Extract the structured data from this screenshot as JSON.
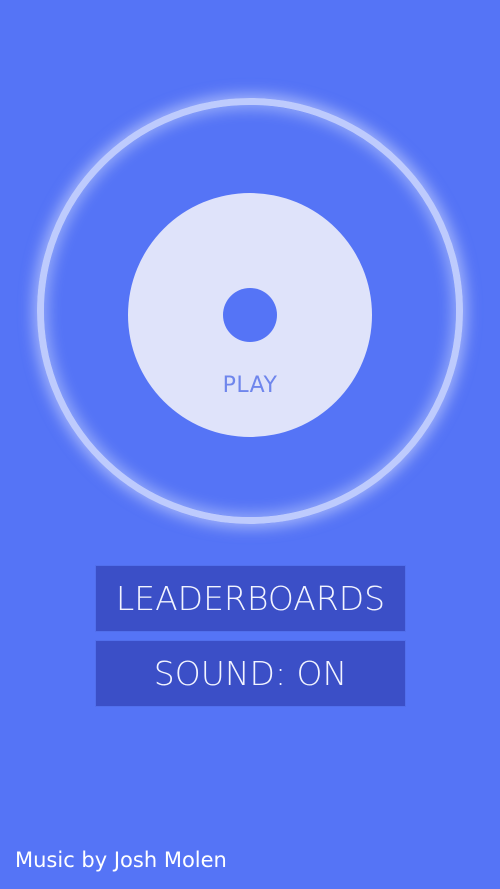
{
  "play_button": {
    "label": "PLAY"
  },
  "menu": {
    "leaderboards_label": "LEADERBOARDS",
    "sound_label": "SOUND: ON"
  },
  "footer": {
    "credit": "Music by Josh Molen"
  },
  "colors": {
    "background": "#5574f6",
    "disc": "#dfe3fa",
    "button": "#3b4fc7",
    "play_text": "#6f86ec",
    "ring": "#dde4ff"
  }
}
